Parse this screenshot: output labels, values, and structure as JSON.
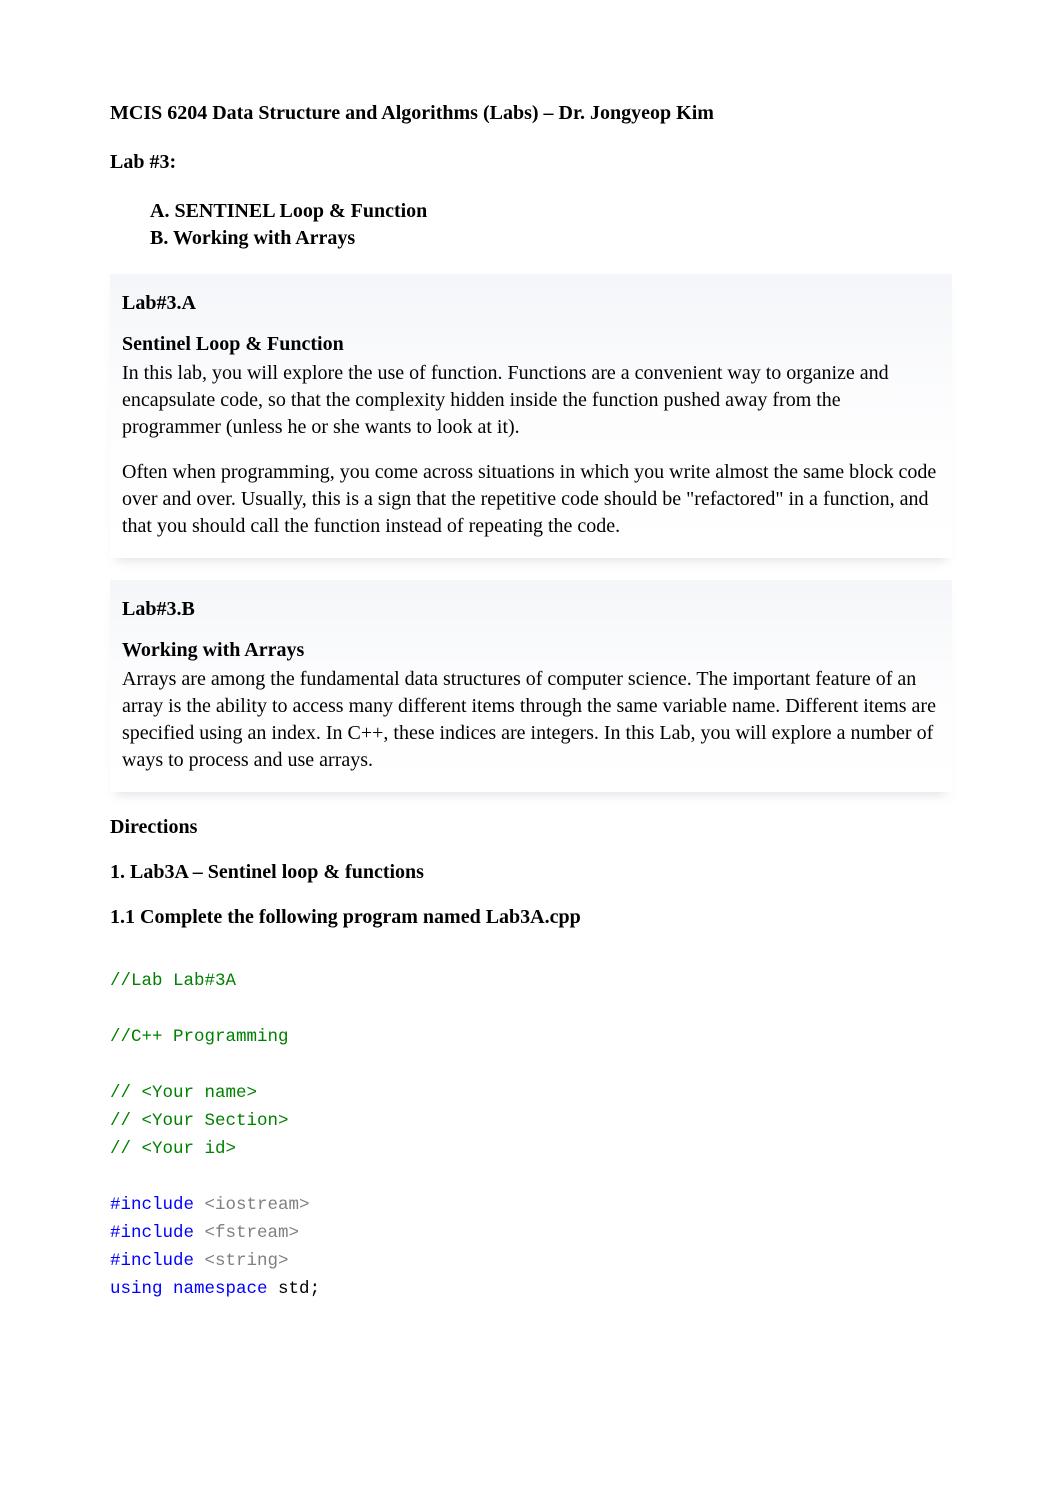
{
  "title": "MCIS 6204 Data Structure and Algorithms (Labs) – Dr. Jongyeop Kim",
  "labHeading": "Lab #3:",
  "topics": {
    "a": "A. SENTINEL Loop & Function",
    "b": "B. Working with Arrays"
  },
  "calloutA": {
    "heading": "Lab#3.A",
    "subheading": "Sentinel Loop & Function",
    "para1": "In this lab, you will explore the use of function. Functions are a convenient way to organize and encapsulate code, so that the complexity hidden inside the function pushed away from the programmer (unless he or she wants to look at it).",
    "para2": "Often when programming, you come across situations in which you write almost the same block code over and over. Usually, this is a sign that the repetitive code should be \"refactored\" in a function, and that you should call the function instead of repeating the code."
  },
  "calloutB": {
    "heading": "Lab#3.B",
    "subheading": "Working with Arrays",
    "para1": "Arrays are among the fundamental data structures of computer science. The important feature of an array is the ability to access many different items through the same variable name. Different items are specified using an index. In C++, these indices are integers. In this Lab, you will explore a number of ways to process and use arrays."
  },
  "directions": "Directions",
  "section1": "1. Lab3A – Sentinel loop & functions",
  "section11": "1.1 Complete the following program named Lab3A.cpp",
  "code": {
    "c1": "//Lab Lab#3A",
    "c2": "//C++ Programming",
    "c3": "// <Your name>",
    "c4": "// <Your Section>",
    "c5": "// <Your id>",
    "inc1a": "#include",
    "inc1b": " <iostream>",
    "inc2a": "#include",
    "inc2b": " <fstream>",
    "inc3a": "#include",
    "inc3b": " <string>",
    "ns1": "using",
    "ns2": " namespace",
    "ns3": " std",
    "ns4": ";"
  }
}
